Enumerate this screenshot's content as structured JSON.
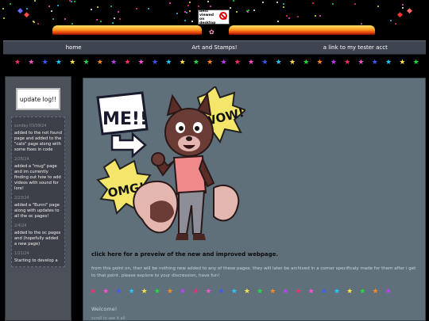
{
  "header": {
    "badge_text": "best viewed on desktop",
    "badge_icon": "no-phone-icon",
    "flame_color": "#ff7a12"
  },
  "nav": {
    "items": [
      {
        "label": "home"
      },
      {
        "label": "Art and Stamps!"
      },
      {
        "label": "a link to my tester acct"
      }
    ]
  },
  "star_colors": [
    "#ff2b6d",
    "#ff4fd8",
    "#3b5bff",
    "#22c9ff",
    "#ffe14a",
    "#1fe03a",
    "#ff8a1f",
    "#c03bff"
  ],
  "sidebar": {
    "title": "update log!!",
    "entries": [
      {
        "date": "sunday 03/09/24",
        "text": "added to the not found page and added to the \"cats\" page along with some fixes in code"
      },
      {
        "date": "2/26/24",
        "text": "added a \"mug\" page and im currently finding out how to add videos with sound for lore!"
      },
      {
        "date": "2/23/24",
        "text": "added a \"Bunni\" page along with updates to all the oc pages!"
      },
      {
        "date": "2/4/24",
        "text": "added to the oc pages and (hopefully added a new page)"
      },
      {
        "date": "1/21/24",
        "text": "Starting to develop a"
      }
    ]
  },
  "main": {
    "art": {
      "bubble_me": "ME!!",
      "bubble_wow": "WOW!",
      "bubble_omg": "OMG!"
    },
    "preview_link": "click here for a preveiw of the new and improved webpage.",
    "notice": "from this point on, ther will be nothing new added to any of these pages. they will later be archived in a corner specificaly made for them after i get to that point. please explore to your discression, have fun!",
    "welcome": "Welcome!",
    "footer_fragment": "scroll to see it all"
  }
}
